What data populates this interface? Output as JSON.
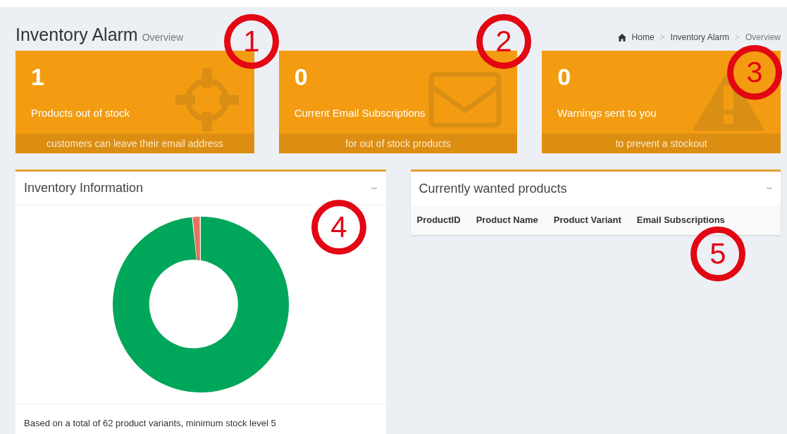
{
  "header": {
    "title": "Inventory Alarm",
    "subtitle": "Overview"
  },
  "breadcrumb": [
    "Home",
    "Inventory Alarm",
    "Overview"
  ],
  "breadcrumb_separator": ">",
  "stat_cards": [
    {
      "kind": "target",
      "value": "1",
      "label": "Products out of stock",
      "footer": "customers can leave their email address"
    },
    {
      "kind": "envelope",
      "value": "0",
      "label": "Current Email Subscriptions",
      "footer": "for out of stock products"
    },
    {
      "kind": "warning",
      "value": "0",
      "label": "Warnings sent to you",
      "footer": "to prevent a stockout"
    }
  ],
  "inventory_panel": {
    "title": "Inventory Information",
    "collapse": "−",
    "footer": "Based on a total of 62 product variants, minimum stock level 5"
  },
  "wanted_panel": {
    "title": "Currently wanted products",
    "collapse": "−",
    "table": {
      "columns": [
        "ProductID",
        "Product Name",
        "Product Variant",
        "Email Subscriptions"
      ]
    }
  },
  "annotations": [
    "1",
    "2",
    "3",
    "4",
    "5"
  ]
}
